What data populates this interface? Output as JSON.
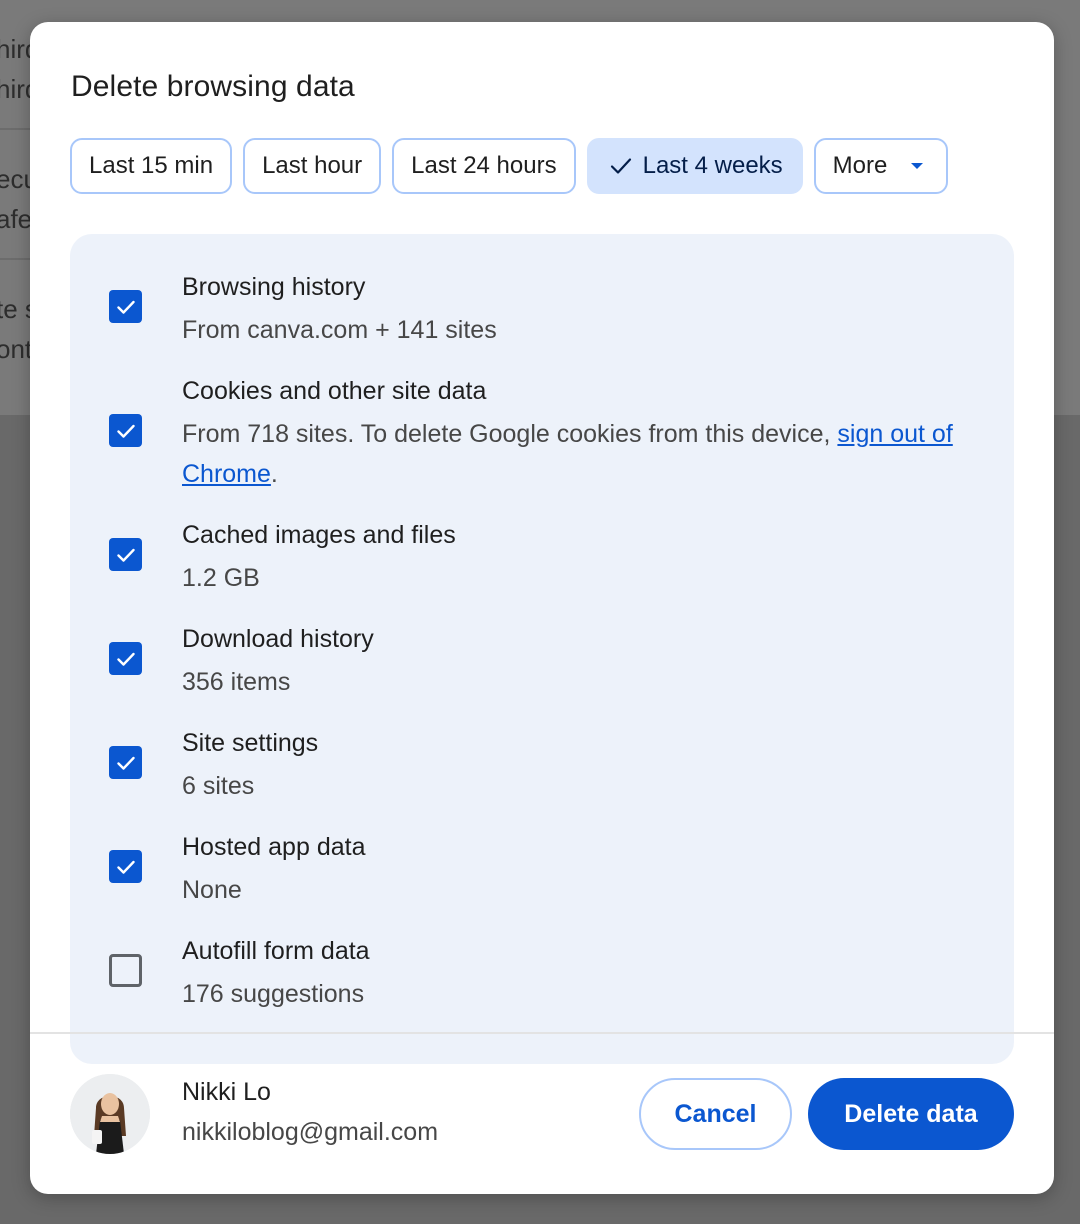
{
  "background_page": {
    "rows": [
      [
        "hird",
        "hird"
      ],
      [
        "ecu",
        "afe"
      ],
      [
        "te s",
        "ont"
      ]
    ]
  },
  "dialog": {
    "title": "Delete browsing data",
    "time_ranges": [
      {
        "label": "Last 15 min",
        "selected": false
      },
      {
        "label": "Last hour",
        "selected": false
      },
      {
        "label": "Last 24 hours",
        "selected": false
      },
      {
        "label": "Last 4 weeks",
        "selected": true
      },
      {
        "label": "More",
        "selected": false
      }
    ],
    "options": [
      {
        "title": "Browsing history",
        "subtitle": "From canva.com + 141 sites",
        "checked": true
      },
      {
        "title": "Cookies and other site data",
        "subtitle": "From 718 sites. To delete Google cookies from this device, ",
        "link": "sign out of Chrome",
        "subtitle_end": ".",
        "checked": true
      },
      {
        "title": "Cached images and files",
        "subtitle": "1.2 GB",
        "checked": true
      },
      {
        "title": "Download history",
        "subtitle": "356 items",
        "checked": true
      },
      {
        "title": "Site settings",
        "subtitle": "6 sites",
        "checked": true
      },
      {
        "title": "Hosted app data",
        "subtitle": "None",
        "checked": true
      },
      {
        "title": "Autofill form data",
        "subtitle": "176 suggestions",
        "checked": false
      }
    ],
    "account": {
      "name": "Nikki Lo",
      "email": "nikkiloblog@gmail.com"
    },
    "buttons": {
      "cancel": "Cancel",
      "delete": "Delete data"
    }
  },
  "colors": {
    "accent": "#0b57d0",
    "chip_border": "#a8c7fa",
    "chip_selected_bg": "#d3e3fd",
    "panel_bg": "#edf2fa"
  },
  "icons": {
    "chip_selected": "check-icon",
    "more_dropdown": "caret-down-icon",
    "checkbox_checked": "checkmark-icon"
  }
}
